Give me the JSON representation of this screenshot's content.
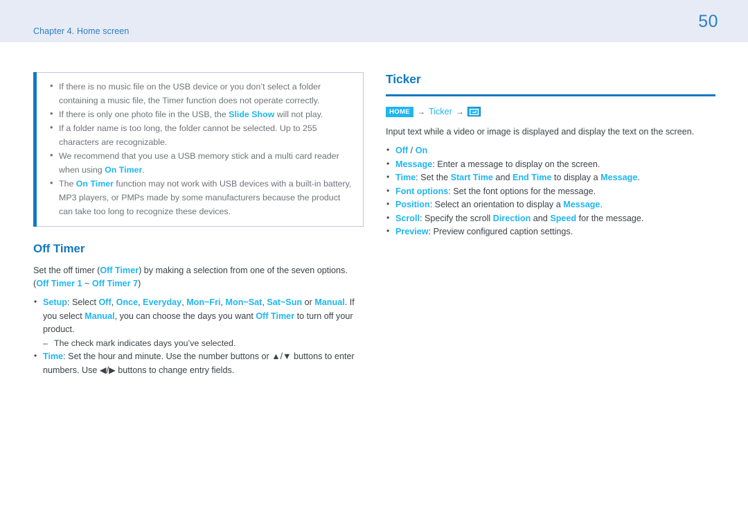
{
  "header": {
    "chapter": "Chapter 4. Home screen",
    "page_number": "50",
    "band_color": "#e7ebf5",
    "text_color": "#2b7fc4"
  },
  "colors": {
    "heading_blue": "#1179c1",
    "highlight_cyan": "#1fb6ef",
    "body_gray": "#3d4246",
    "note_gray": "#6f7378",
    "note_border": "#c3c8e0",
    "note_bar": "#1179c1"
  },
  "left_column": {
    "note_box": {
      "items": [
        {
          "segments": [
            {
              "text": "If there is no music file on the USB device or you don’t select a folder containing a music file, the Timer function does not operate correctly.",
              "style": "plain"
            }
          ]
        },
        {
          "segments": [
            {
              "text": "If there is only one photo file in the USB, the ",
              "style": "plain"
            },
            {
              "text": "Slide Show",
              "style": "highlight"
            },
            {
              "text": " will not play.",
              "style": "plain"
            }
          ]
        },
        {
          "segments": [
            {
              "text": "If a folder name is too long, the folder cannot be selected. Up to 255 characters are recognizable.",
              "style": "plain"
            }
          ]
        },
        {
          "segments": [
            {
              "text": "We recommend that you use a USB memory stick and a multi card reader when using ",
              "style": "plain"
            },
            {
              "text": "On Timer",
              "style": "highlight"
            },
            {
              "text": ".",
              "style": "plain"
            }
          ]
        },
        {
          "segments": [
            {
              "text": "The ",
              "style": "plain"
            },
            {
              "text": "On Timer",
              "style": "highlight"
            },
            {
              "text": " function may not work with USB devices with a built-in battery, MP3 players, or PMPs made by some manufacturers because the product can take too long to recognize these devices.",
              "style": "plain"
            }
          ]
        }
      ]
    },
    "section": {
      "heading": "Off Timer",
      "intro": [
        {
          "text": "Set the off timer (",
          "style": "plain"
        },
        {
          "text": "Off Timer",
          "style": "highlight"
        },
        {
          "text": ") by making a selection from one of the seven options. (",
          "style": "plain"
        },
        {
          "text": "Off Timer 1",
          "style": "highlight"
        },
        {
          "text": " ~ ",
          "style": "plain"
        },
        {
          "text": "Off Timer 7",
          "style": "highlight"
        },
        {
          "text": ")",
          "style": "plain"
        }
      ],
      "bullets": [
        {
          "segments": [
            {
              "text": "Setup",
              "style": "highlight"
            },
            {
              "text": ": Select ",
              "style": "plain"
            },
            {
              "text": "Off",
              "style": "highlight"
            },
            {
              "text": ", ",
              "style": "plain"
            },
            {
              "text": "Once",
              "style": "highlight"
            },
            {
              "text": ", ",
              "style": "plain"
            },
            {
              "text": "Everyday",
              "style": "highlight"
            },
            {
              "text": ", ",
              "style": "plain"
            },
            {
              "text": "Mon~Fri",
              "style": "highlight"
            },
            {
              "text": ", ",
              "style": "plain"
            },
            {
              "text": "Mon~Sat",
              "style": "highlight"
            },
            {
              "text": ", ",
              "style": "plain"
            },
            {
              "text": "Sat~Sun",
              "style": "highlight"
            },
            {
              "text": " or ",
              "style": "plain"
            },
            {
              "text": "Manual",
              "style": "highlight"
            },
            {
              "text": ". If you select ",
              "style": "plain"
            },
            {
              "text": "Manual",
              "style": "highlight"
            },
            {
              "text": ", you can choose the days you want ",
              "style": "plain"
            },
            {
              "text": "Off Timer",
              "style": "highlight"
            },
            {
              "text": " to turn off your product.",
              "style": "plain"
            }
          ],
          "sub_items": [
            {
              "segments": [
                {
                  "text": "The check mark indicates days you’ve selected.",
                  "style": "plain"
                }
              ]
            }
          ]
        },
        {
          "segments": [
            {
              "text": "Time",
              "style": "highlight"
            },
            {
              "text": ": Set the hour and minute. Use the number buttons or ▲/▼ buttons to enter numbers. Use ◀/▶ buttons to change entry fields.",
              "style": "plain"
            }
          ],
          "sub_items": []
        }
      ]
    }
  },
  "right_column": {
    "section": {
      "heading": "Ticker",
      "breadcrumb": {
        "badge": "HOME",
        "arrow": "→",
        "item": "Ticker",
        "icon_name": "enter-key-icon"
      },
      "intro": "Input text while a video or image is displayed and display the text on the screen.",
      "bullets": [
        {
          "segments": [
            {
              "text": "Off",
              "style": "highlight"
            },
            {
              "text": " / ",
              "style": "plain"
            },
            {
              "text": "On",
              "style": "highlight"
            }
          ]
        },
        {
          "segments": [
            {
              "text": "Message",
              "style": "highlight"
            },
            {
              "text": ": Enter a message to display on the screen.",
              "style": "plain"
            }
          ]
        },
        {
          "segments": [
            {
              "text": "Time",
              "style": "highlight"
            },
            {
              "text": ": Set the ",
              "style": "plain"
            },
            {
              "text": "Start Time",
              "style": "highlight"
            },
            {
              "text": " and ",
              "style": "plain"
            },
            {
              "text": "End Time",
              "style": "highlight"
            },
            {
              "text": " to display a ",
              "style": "plain"
            },
            {
              "text": "Message",
              "style": "highlight"
            },
            {
              "text": ".",
              "style": "plain"
            }
          ]
        },
        {
          "segments": [
            {
              "text": "Font options",
              "style": "highlight"
            },
            {
              "text": ": Set the font options for the message.",
              "style": "plain"
            }
          ]
        },
        {
          "segments": [
            {
              "text": "Position",
              "style": "highlight"
            },
            {
              "text": ": Select an orientation to display a ",
              "style": "plain"
            },
            {
              "text": "Message",
              "style": "highlight"
            },
            {
              "text": ".",
              "style": "plain"
            }
          ]
        },
        {
          "segments": [
            {
              "text": "Scroll",
              "style": "highlight"
            },
            {
              "text": ": Specify the scroll ",
              "style": "plain"
            },
            {
              "text": "Direction",
              "style": "highlight"
            },
            {
              "text": " and ",
              "style": "plain"
            },
            {
              "text": "Speed",
              "style": "highlight"
            },
            {
              "text": " for the message.",
              "style": "plain"
            }
          ]
        },
        {
          "segments": [
            {
              "text": "Preview",
              "style": "highlight"
            },
            {
              "text": ": Preview configured caption settings.",
              "style": "plain"
            }
          ]
        }
      ]
    }
  }
}
